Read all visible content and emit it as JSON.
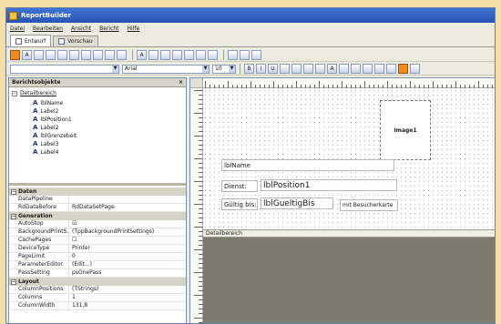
{
  "window": {
    "title": "ReportBuilder"
  },
  "menu": [
    "Datei",
    "Bearbeiten",
    "Ansicht",
    "Bericht",
    "Hilfe"
  ],
  "tabs": [
    {
      "label": "Entwurf",
      "active": true
    },
    {
      "label": "Vorschau",
      "active": false
    }
  ],
  "font_combo": {
    "value": "Arial"
  },
  "size_combo": {
    "value": "10"
  },
  "report_objects": {
    "title": "Berichtsobjekte",
    "close_glyph": "×",
    "root": "Detailbereich",
    "items": [
      "lblName",
      "Label2",
      "lblPosition1",
      "Label2",
      "lblGrenzebeit",
      "Label3",
      "Label4"
    ]
  },
  "properties": {
    "sections": [
      {
        "title": "Daten",
        "rows": [
          {
            "name": "DataPipeline",
            "value": ""
          },
          {
            "name": "RdDataBefore",
            "value": "RdDataSetPage"
          }
        ]
      },
      {
        "title": "Generation",
        "rows": [
          {
            "name": "AutoStop",
            "value": "☑"
          },
          {
            "name": "BackgroundPrintS...",
            "value": "(TppBackgroundPrintSettings)"
          },
          {
            "name": "CachePages",
            "value": "☐"
          },
          {
            "name": "DeviceType",
            "value": "Printer"
          },
          {
            "name": "PageLimit",
            "value": "0"
          },
          {
            "name": "ParameterEditor",
            "value": "(Edit...)"
          },
          {
            "name": "PassSetting",
            "value": "psOnePass"
          }
        ]
      },
      {
        "title": "Layout",
        "rows": [
          {
            "name": "ColumnPositions",
            "value": "(TStrings)"
          },
          {
            "name": "Columns",
            "value": "1"
          },
          {
            "name": "ColumnWidth",
            "value": "131,8"
          }
        ]
      }
    ]
  },
  "design": {
    "band_label": "Detailbereich",
    "image_label": "Image1",
    "fields": {
      "name": "lblName",
      "dienst_label": "Dienst:",
      "position": "lblPosition1",
      "gueltig_label": "Gültig bis:",
      "gueltig_value": "lblGueltigBis",
      "besucher": "mit Besucherkarte"
    }
  },
  "colors": {
    "accent": "#2754b4",
    "background": "#f4dfa6",
    "design_surface": "#7c7b6f"
  }
}
